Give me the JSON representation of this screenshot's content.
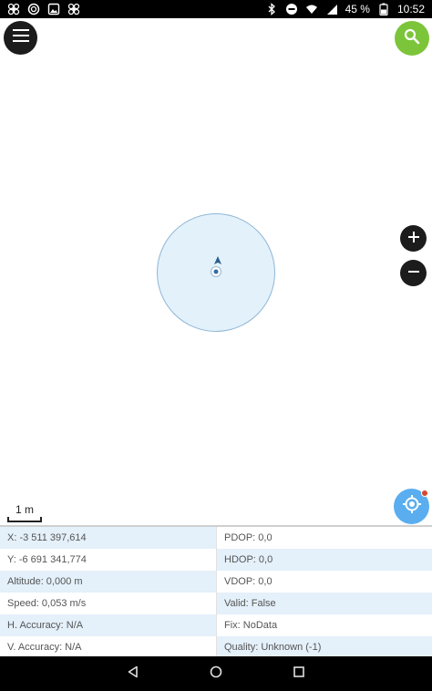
{
  "status_bar": {
    "battery_percent": "45 %",
    "time": "10:52",
    "left_icons": [
      "fan-icon",
      "sync-icon",
      "image-icon",
      "fan-icon"
    ],
    "right_icons": [
      "bluetooth-icon",
      "dnd-icon",
      "wifi-icon",
      "signal-icon",
      "battery-icon"
    ]
  },
  "map": {
    "scale_label": "1 m",
    "accent_color": "#5aaef0",
    "search_color": "#7cc53a"
  },
  "info_rows": [
    {
      "left": "X: -3 511 397,614",
      "right": "PDOP: 0,0"
    },
    {
      "left": "Y: -6 691 341,774",
      "right": "HDOP: 0,0"
    },
    {
      "left": "Altitude: 0,000 m",
      "right": "VDOP: 0,0"
    },
    {
      "left": "Speed: 0,053 m/s",
      "right": "Valid: False"
    },
    {
      "left": "H. Accuracy: N/A",
      "right": "Fix: NoData"
    },
    {
      "left": "V. Accuracy: N/A",
      "right": "Quality: Unknown (-1)"
    }
  ]
}
